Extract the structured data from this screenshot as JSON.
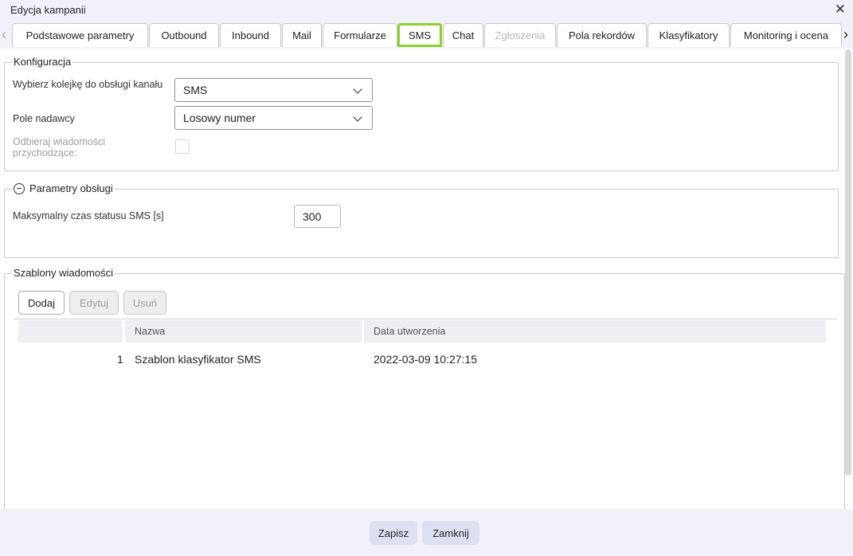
{
  "window": {
    "title": "Edycja kampanii"
  },
  "tabs": [
    {
      "label": "Podstawowe parametry",
      "state": "normal"
    },
    {
      "label": "Outbound",
      "state": "normal"
    },
    {
      "label": "Inbound",
      "state": "normal"
    },
    {
      "label": "Mail",
      "state": "normal"
    },
    {
      "label": "Formularze",
      "state": "normal"
    },
    {
      "label": "SMS",
      "state": "selected"
    },
    {
      "label": "Chat",
      "state": "normal"
    },
    {
      "label": "Zgłoszenia",
      "state": "disabled"
    },
    {
      "label": "Pola rekordów",
      "state": "normal"
    },
    {
      "label": "Klasyfikatory",
      "state": "normal"
    },
    {
      "label": "Monitoring i ocena",
      "state": "normal"
    }
  ],
  "konfiguracja": {
    "legend": "Konfiguracja",
    "queue_label": "Wybierz kolejkę do obsługi kanału",
    "queue_value": "SMS",
    "sender_label": "Pole nadawcy",
    "sender_value": "Losowy numer",
    "incoming_label": "Odbieraj wiadomości przychodzące:",
    "incoming_checked": false
  },
  "parametry": {
    "legend": "Parametry obsługi",
    "max_time_label": "Maksymalny czas statusu SMS [s]",
    "max_time_value": "300"
  },
  "szablony": {
    "legend": "Szablony wiadomości",
    "add_label": "Dodaj",
    "edit_label": "Edytuj",
    "delete_label": "Usuń",
    "columns": [
      "Nazwa",
      "Data utworzenia"
    ],
    "rows": [
      {
        "index": "1",
        "name": "Szablon klasyfikator SMS",
        "created": "2022-03-09 10:27:15"
      }
    ]
  },
  "footer": {
    "save_label": "Zapisz",
    "close_label": "Zamknij"
  },
  "colors": {
    "selected_tab_border": "#8bd12b",
    "footer_button": "#dde0f3",
    "chrome_bg": "#f1f2f9"
  }
}
